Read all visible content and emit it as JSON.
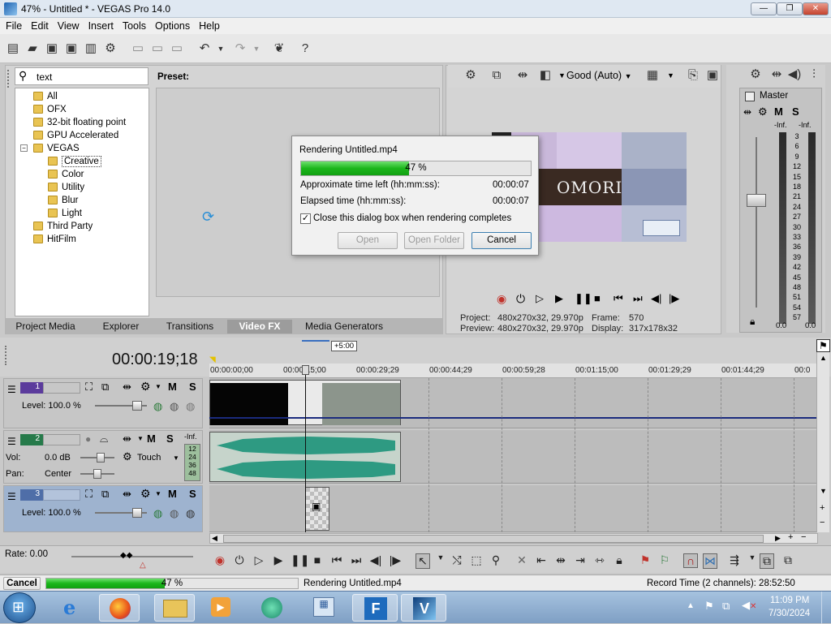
{
  "window": {
    "title": "47% - Untitled * - VEGAS Pro 14.0",
    "min": "—",
    "max": "❐",
    "close": "✕"
  },
  "menu": [
    "File",
    "Edit",
    "View",
    "Insert",
    "Tools",
    "Options",
    "Help"
  ],
  "explorer": {
    "search_value": "text",
    "preset_label": "Preset:",
    "tree": [
      {
        "label": "All",
        "indent": 0
      },
      {
        "label": "OFX",
        "indent": 0
      },
      {
        "label": "32-bit floating point",
        "indent": 0
      },
      {
        "label": "GPU Accelerated",
        "indent": 0
      },
      {
        "label": "VEGAS",
        "indent": 0,
        "expander": "−"
      },
      {
        "label": "Creative",
        "indent": 1,
        "selected": true
      },
      {
        "label": "Color",
        "indent": 1
      },
      {
        "label": "Utility",
        "indent": 1
      },
      {
        "label": "Blur",
        "indent": 1
      },
      {
        "label": "Light",
        "indent": 1
      },
      {
        "label": "Third Party",
        "indent": 0
      },
      {
        "label": "HitFilm",
        "indent": 0
      }
    ],
    "tabs": [
      {
        "label": "Project Media"
      },
      {
        "label": "Explorer"
      },
      {
        "label": "Transitions"
      },
      {
        "label": "Video FX",
        "selected": true
      },
      {
        "label": "Media Generators"
      }
    ]
  },
  "preview": {
    "quality": "Good (Auto)",
    "video_text": "OMORI",
    "project_label": "Project:",
    "project_value": "480x270x32, 29.970p",
    "preview_label": "Preview:",
    "preview_value": "480x270x32, 29.970p",
    "frame_label": "Frame:",
    "frame_value": "570",
    "display_label": "Display:",
    "display_value": "317x178x32"
  },
  "mixer": {
    "master_label": "Master",
    "inf_left": "-Inf.",
    "inf_right": "-Inf.",
    "scale": [
      "3",
      "6",
      "9",
      "12",
      "15",
      "18",
      "21",
      "24",
      "27",
      "30",
      "33",
      "36",
      "39",
      "42",
      "45",
      "48",
      "51",
      "54",
      "57"
    ],
    "val_left": "0.0",
    "val_right": "0.0"
  },
  "render_dialog": {
    "title": "Rendering Untitled.mp4",
    "progress_pct": 47,
    "progress_label": "47 %",
    "time_left_label": "Approximate time left (hh:mm:ss):",
    "time_left_value": "00:00:07",
    "elapsed_label": "Elapsed time (hh:mm:ss):",
    "elapsed_value": "00:00:07",
    "close_checkbox_label": "Close this dialog box when rendering completes",
    "close_checked": true,
    "open_btn": "Open",
    "open_folder_btn": "Open Folder",
    "cancel_btn": "Cancel"
  },
  "timeline": {
    "timecode": "00:00:19;18",
    "offset_badge": "+5:00",
    "ruler": [
      "00:00:00;00",
      "00:00:15;00",
      "00:00:29;29",
      "00:00:44;29",
      "00:00:59;28",
      "00:01:15;00",
      "00:01:29;29",
      "00:01:44;29",
      "00:0"
    ],
    "tracks": [
      {
        "num": "1",
        "level_label": "Level: 100.0 %",
        "m": "M",
        "s": "S"
      },
      {
        "num": "2",
        "vol_label": "Vol:",
        "vol_value": "0.0 dB",
        "pan_label": "Pan:",
        "pan_value": "Center",
        "touch": "Touch",
        "m": "M",
        "s": "S",
        "meter_inf": "-Inf.",
        "meter_scale": [
          "12",
          "24",
          "36",
          "48"
        ]
      },
      {
        "num": "3",
        "level_label": "Level: 100.0 %",
        "m": "M",
        "s": "S"
      }
    ],
    "rate_label": "Rate: 0.00"
  },
  "status": {
    "cancel_btn": "Cancel",
    "progress_pct": 47,
    "progress_label": "47 %",
    "render_text": "Rendering Untitled.mp4",
    "record_time": "Record Time (2 channels): 28:52:50"
  },
  "taskbar": {
    "time": "11:09 PM",
    "date": "7/30/2024"
  },
  "colors": {
    "accent": "#2f6fb2",
    "progress": "#1bb61b",
    "selected_track": "#9eb3cf"
  }
}
